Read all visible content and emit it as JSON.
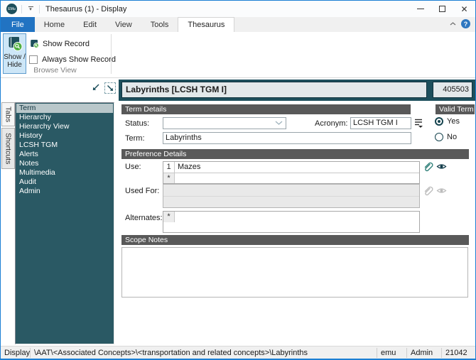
{
  "window": {
    "logo_text": "EMu",
    "title": "Thesaurus (1) - Display"
  },
  "ribbon": {
    "tabs": [
      "File",
      "Home",
      "Edit",
      "View",
      "Tools",
      "Thesaurus"
    ],
    "active_tab": "Thesaurus",
    "browse_view": {
      "show_hide_label": "Show / Hide",
      "show_record_label": "Show Record",
      "always_show_record_label": "Always Show Record",
      "always_show_record_checked": false,
      "group_label": "Browse View"
    }
  },
  "record_header": {
    "title": "Labyrinths [LCSH TGM I]",
    "record_number": "405503"
  },
  "sidebar": {
    "tab_tabs": "Tabs",
    "tab_shortcuts": "Shortcuts",
    "selected_item": "Term",
    "items": [
      "Term",
      "Hierarchy",
      "Hierarchy View",
      "History",
      "LCSH TGM",
      "Alerts",
      "Notes",
      "Multimedia",
      "Audit",
      "Admin"
    ]
  },
  "term_details": {
    "header": "Term Details",
    "status_label": "Status:",
    "status_value": "",
    "acronym_label": "Acronym:",
    "acronym_value": "LCSH TGM I",
    "term_label": "Term:",
    "term_value": "Labyrinths"
  },
  "valid_term": {
    "header": "Valid Term",
    "yes_label": "Yes",
    "no_label": "No",
    "selected": "Yes"
  },
  "preference_details": {
    "header": "Preference Details",
    "use_label": "Use:",
    "use_rows": [
      {
        "num": "1",
        "value": "Mazes"
      },
      {
        "num": "*",
        "value": ""
      }
    ],
    "used_for_label": "Used For:",
    "used_for_value": "",
    "alternates_label": "Alternates:",
    "alternates_rows": [
      {
        "num": "*",
        "value": ""
      }
    ]
  },
  "scope_notes": {
    "header": "Scope Notes",
    "value": ""
  },
  "statusbar": {
    "mode": "Display",
    "path": "\\AAT\\<Associated Concepts>\\<transportation and related concepts>\\Labyrinths",
    "database": "emu",
    "user": "Admin",
    "record_count": "21042"
  },
  "colors": {
    "teal_dark": "#1d4f5c",
    "teal_panel": "#2a5964",
    "selected_item_bg": "#b9c7ca",
    "accent_blue": "#2173c2",
    "section_header_gray": "#595959",
    "window_border_blue": "#1b7fd4",
    "icon_green": "#52b043"
  }
}
